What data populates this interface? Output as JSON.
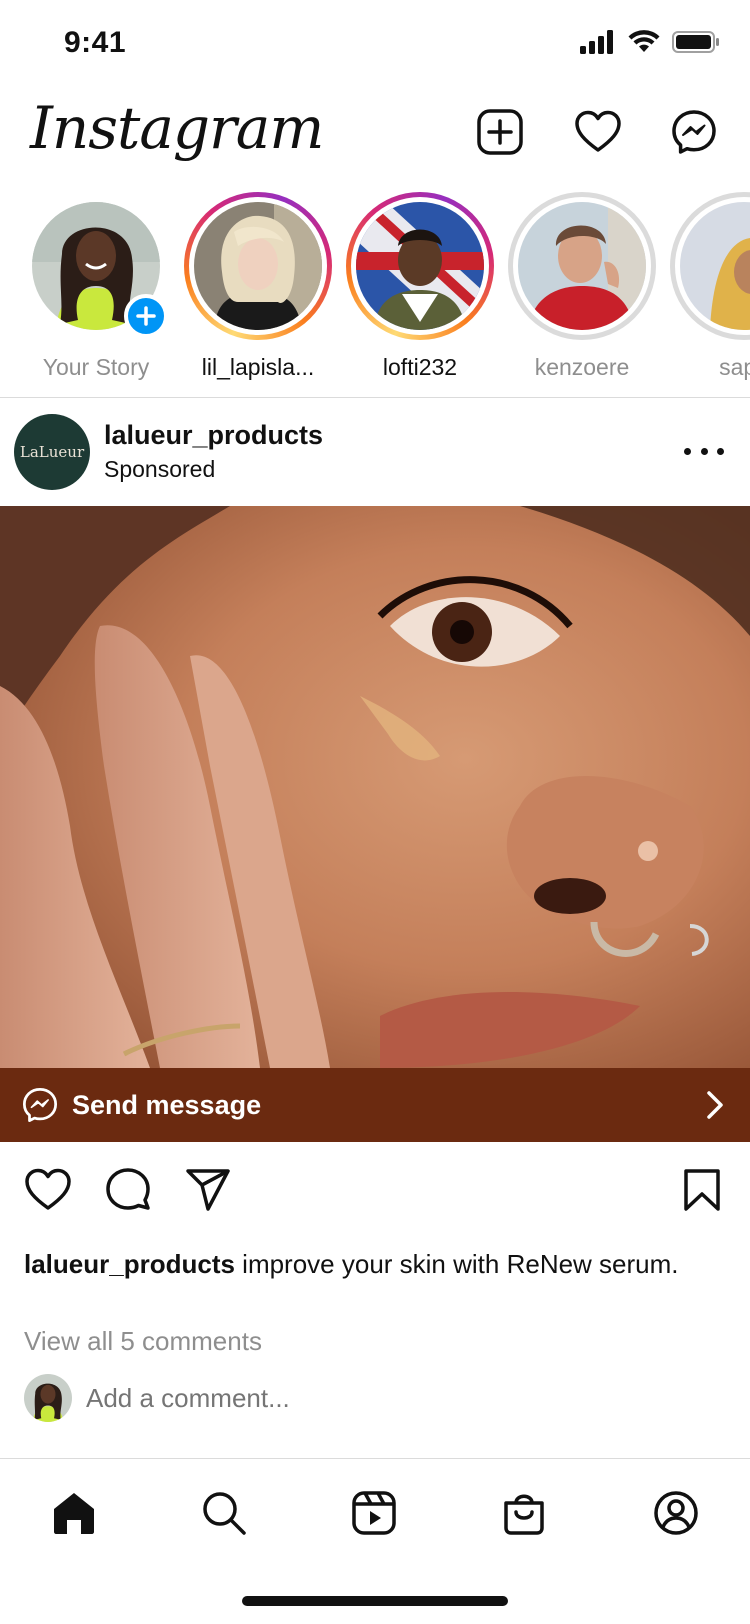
{
  "status_bar": {
    "time": "9:41",
    "icons": [
      "cellular-signal-icon",
      "wifi-icon",
      "battery-icon"
    ]
  },
  "header": {
    "logo_text": "Instagram",
    "actions": [
      "new-post-icon",
      "activity-heart-icon",
      "messenger-icon"
    ]
  },
  "stories": [
    {
      "label": "Your Story",
      "ring": "none",
      "has_add_badge": true,
      "avatar": "avatar-your-story"
    },
    {
      "label": "lil_lapisla...",
      "ring": "active",
      "avatar": "avatar-lil-lapisla"
    },
    {
      "label": "lofti232",
      "ring": "active",
      "avatar": "avatar-lofti232"
    },
    {
      "label": "kenzoere",
      "ring": "seen",
      "avatar": "avatar-kenzoere"
    },
    {
      "label": "sapp",
      "ring": "seen",
      "avatar": "avatar-sapp"
    }
  ],
  "post": {
    "username": "lalueur_products",
    "subtitle": "Sponsored",
    "avatar_text": "LaLueur",
    "image": "close-up-face-serum-photo",
    "cta": {
      "label": "Send message",
      "icon": "messenger-icon",
      "background": "#6b2a10"
    },
    "actions": [
      "like-icon",
      "comment-icon",
      "share-icon",
      "bookmark-icon"
    ],
    "caption_username": "lalueur_products",
    "caption_text": " improve your skin with ReNew serum.",
    "view_comments": "View all 5 comments",
    "comment_placeholder": "Add a comment..."
  },
  "tab_bar": {
    "tabs": [
      "home-icon",
      "search-icon",
      "reels-icon",
      "shop-icon",
      "profile-icon"
    ],
    "active": "home-icon"
  },
  "colors": {
    "accent_blue": "#0095f6",
    "muted_text": "#8e8e8e",
    "divider": "#dbdbdb"
  }
}
